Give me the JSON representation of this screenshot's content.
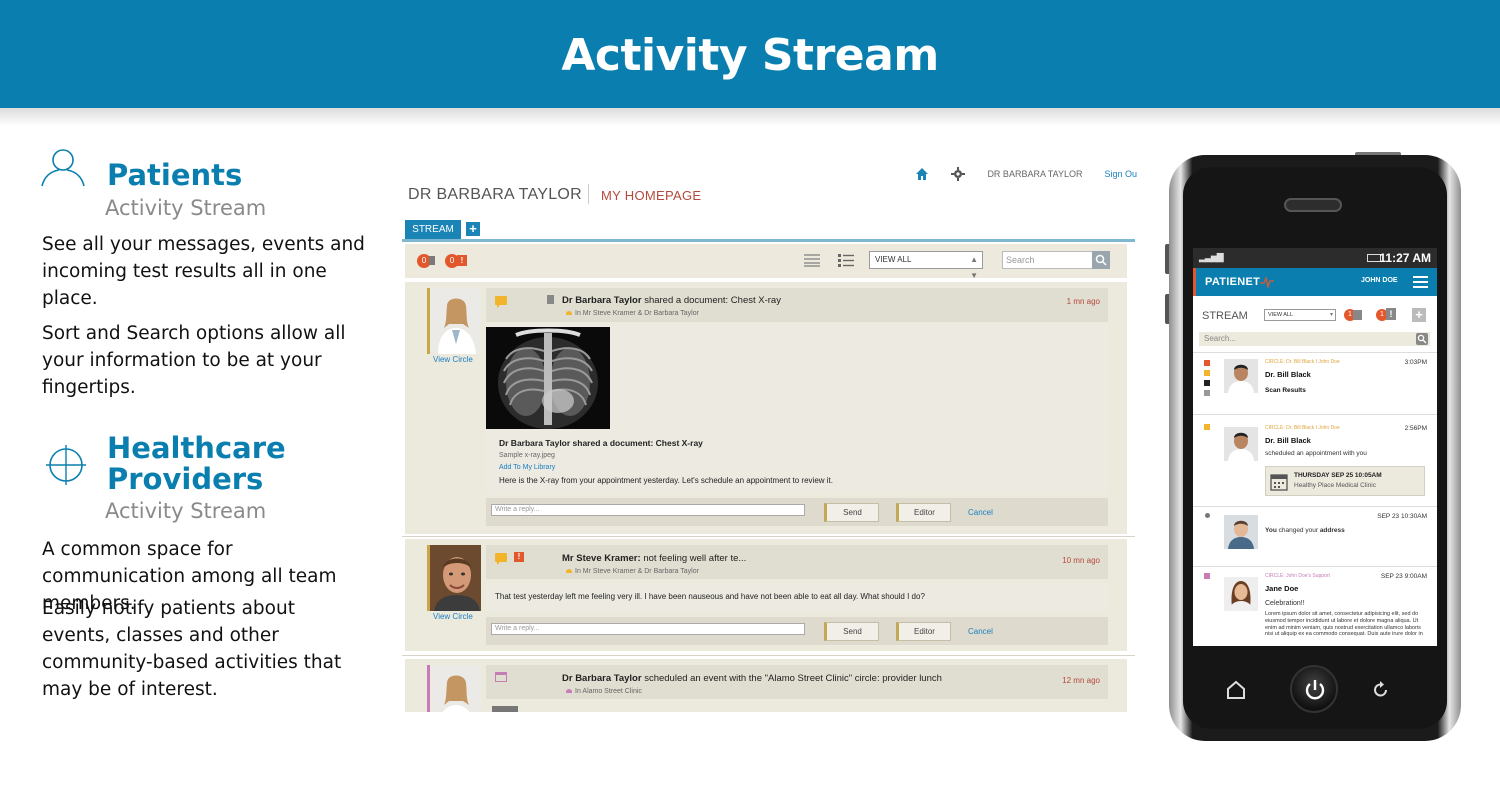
{
  "banner": {
    "title": "Activity Stream"
  },
  "patients": {
    "title": "Patients",
    "subtitle": "Activity Stream",
    "para1": "See all your messages, events and incoming test results all in one place.",
    "para2": "Sort and Search options allow all your information to be at your fingertips."
  },
  "providers": {
    "title_line1": "Healthcare",
    "title_line2": "Providers",
    "subtitle": "Activity Stream",
    "para1": "A common space for communication among all team members.",
    "para2": "Easily notify patients about events, classes and other community-based activities that may be of interest."
  },
  "desktop": {
    "nav_user": "DR BARBARA TAYLOR",
    "nav_signout": "Sign Ou",
    "user_name": "DR BARBARA TAYLOR",
    "homepage": "MY HOMEPAGE",
    "tab_stream": "STREAM",
    "tab_plus": "+",
    "badge_msg": "0",
    "badge_alert": "0",
    "view_all": "VIEW ALL",
    "search_placeholder": "Search",
    "posts": [
      {
        "name": "Dr Barbara Taylor",
        "action": "shared a document: Chest X-ray",
        "circle": "In Mr Steve Kramer & Dr Barbara Taylor",
        "time": "1 mn ago",
        "view_circle": "View Circle",
        "doc_title": "Dr Barbara Taylor shared a document: Chest X-ray",
        "doc_file": "Sample x-ray.jpeg",
        "doc_add": "Add To My Library",
        "message": "Here is the X-ray from your appointment yesterday. Let's schedule an appointment to review it."
      },
      {
        "name": "Mr Steve Kramer:",
        "action": "not feeling well after te...",
        "circle": "In Mr Steve Kramer & Dr Barbara Taylor",
        "time": "10 mn ago",
        "view_circle": "View Circle",
        "message": "That test yesterday left me feeling very ill. I have been nauseous and have not been able to eat all day. What should I do?"
      },
      {
        "name": "Dr Barbara Taylor",
        "action": "scheduled an event with the \"Alamo Street Clinic\" circle: provider lunch",
        "circle": "In Alamo Street Clinic",
        "time": "12 mn ago"
      }
    ],
    "reply_placeholder": "Write a reply...",
    "send": "Send",
    "editor": "Editor",
    "cancel": "Cancel"
  },
  "phone": {
    "time": "11:27 AM",
    "logo": "PATIENET",
    "user": "JOHN DOE",
    "stream": "STREAM",
    "view_all": "VIEW ALL",
    "badge1": "1",
    "badge2": "1",
    "plus": "+",
    "search_placeholder": "Search...",
    "items": [
      {
        "circle": "CIRCLE: Dr. Bill Black I John Doe",
        "time": "3:03PM",
        "name": "Dr. Bill Black",
        "text": "Scan Results"
      },
      {
        "circle": "CIRCLE: Dr. Bill Black I John Doe",
        "time": "2:56PM",
        "name": "Dr. Bill Black",
        "text": "scheduled an appointment with you",
        "event_date": "THURSDAY SEP 25 10:05AM",
        "event_place": "Healthy Place Medical Clinic"
      },
      {
        "time": "SEP 23 10:30AM",
        "text_pre": "You",
        "text_mid": " changed your ",
        "text_post": "address"
      },
      {
        "circle": "CIRCLE: John Doe's Support",
        "time": "SEP 23 9:00AM",
        "name": "Jane Doe",
        "text": "Celebration!!",
        "body": "Lorem ipsum dolor sit amet, consectetur adipisicing elit, sed do eiusmod tempor incididunt ut labore et dolore magna aliqua. Ut enim ad minim veniam, quis nostrud exercitation ullamco laboris nisi ut aliquip ex ea commodo consequat. Duis aute irure dolor in"
      }
    ]
  },
  "colors": {
    "brand": "#0a7faf",
    "accent": "#e3572c",
    "gold": "#c9a647",
    "link": "#1b7fc1"
  }
}
